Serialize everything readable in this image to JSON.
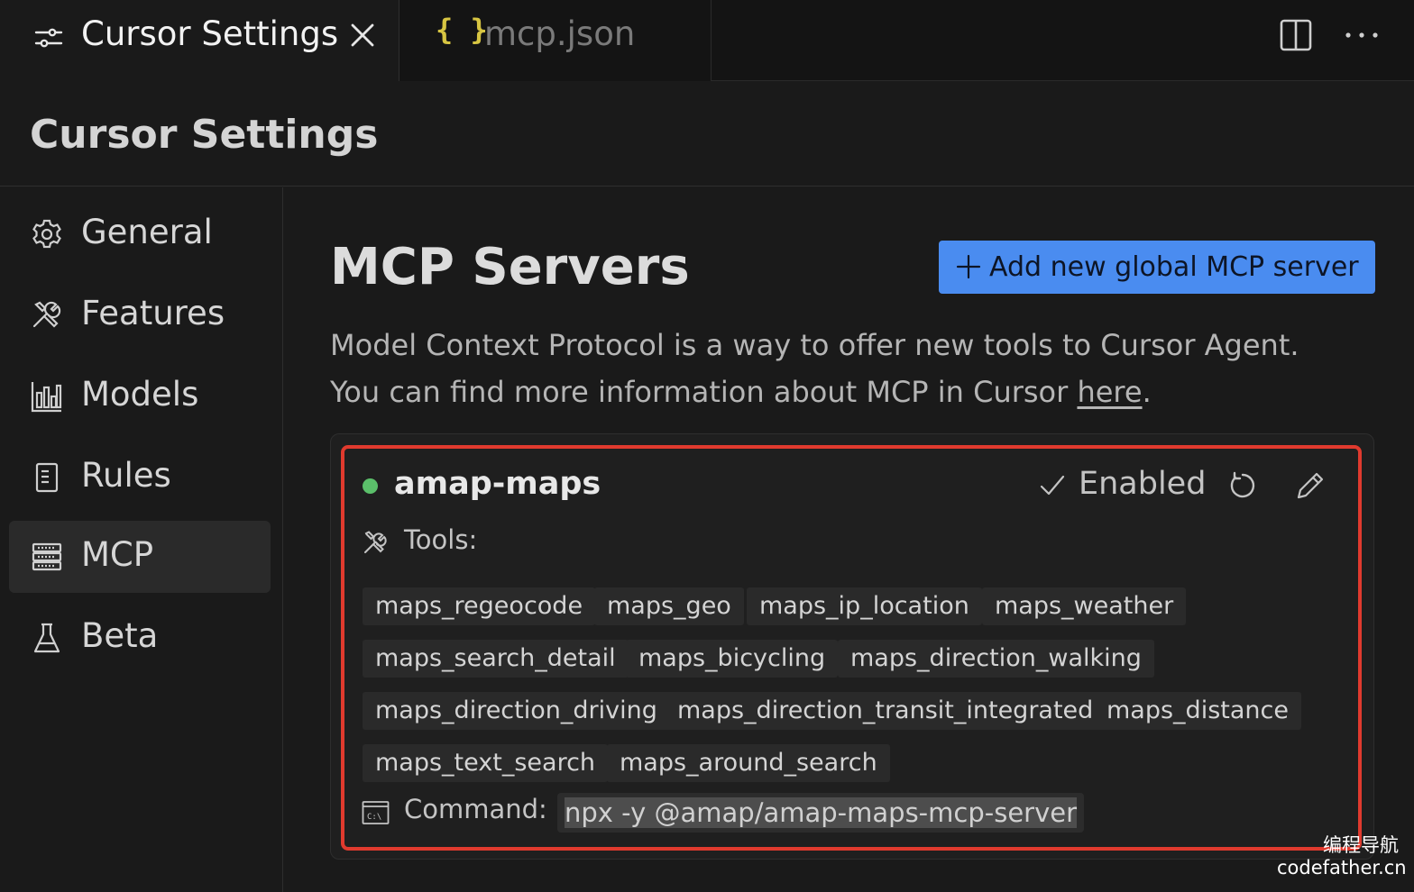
{
  "tabs": [
    {
      "title": "Cursor Settings",
      "icon": "settings-sliders-icon",
      "active": true
    },
    {
      "title": "mcp.json",
      "icon_glyph": "{ }",
      "active": false
    }
  ],
  "page": {
    "title": "Cursor Settings"
  },
  "sidebar": {
    "items": [
      {
        "label": "General",
        "icon": "gear-icon"
      },
      {
        "label": "Features",
        "icon": "tools-icon"
      },
      {
        "label": "Models",
        "icon": "bar-chart-icon"
      },
      {
        "label": "Rules",
        "icon": "document-icon"
      },
      {
        "label": "MCP",
        "icon": "server-icon",
        "active": true
      },
      {
        "label": "Beta",
        "icon": "flask-icon"
      }
    ]
  },
  "main": {
    "title": "MCP Servers",
    "add_button_label": "Add new global MCP server",
    "desc_line1": "Model Context Protocol is a way to offer new tools to Cursor Agent.",
    "desc_line2_prefix": "You can find more information about MCP in Cursor ",
    "desc_link": "here",
    "desc_line2_suffix": "."
  },
  "server": {
    "name": "amap-maps",
    "status_color": "#5bbf6a",
    "enabled_label": "Enabled",
    "tools_label": "Tools:",
    "tools": [
      "maps_regeocode",
      "maps_geo",
      "maps_ip_location",
      "maps_weather",
      "maps_search_detail",
      "maps_bicycling",
      "maps_direction_walking",
      "maps_direction_driving",
      "maps_direction_transit_integrated",
      "maps_distance",
      "maps_text_search",
      "maps_around_search"
    ],
    "command_label": "Command:",
    "command": "npx -y @amap/amap-maps-mcp-server"
  },
  "watermark": {
    "line1": "编程导航",
    "line2": "codefather.cn"
  },
  "colors": {
    "accent": "#4a8cf0",
    "highlight_border": "#e03a2e",
    "background": "#1a1a1a"
  }
}
